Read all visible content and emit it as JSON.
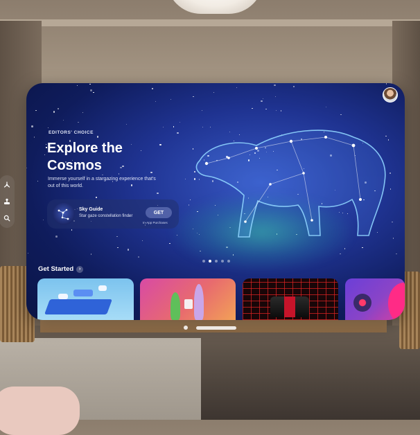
{
  "hero": {
    "eyebrow": "EDITORS' CHOICE",
    "title": "Explore the Cosmos",
    "subtitle": "Immerse yourself in a stargazing experience that's out of this world."
  },
  "featured_app": {
    "name": "Sky Guide",
    "tagline": "Star gaze constellation finder",
    "button_label": "GET",
    "purchase_note": "In-App Purchases"
  },
  "carousel": {
    "pages": 5,
    "active_index": 1
  },
  "section": {
    "title": "Get Started",
    "chevron": "›"
  },
  "tiles": [
    {
      "name": "puzzle-game"
    },
    {
      "name": "chess-game"
    },
    {
      "name": "racing-game"
    },
    {
      "name": "orb-game"
    }
  ],
  "sidebar": {
    "items": [
      {
        "icon": "apps-icon"
      },
      {
        "icon": "arcade-icon"
      },
      {
        "icon": "search-icon"
      }
    ]
  },
  "colors": {
    "sky_deep": "#0f1c5c",
    "sky_mid": "#1f3391",
    "constellation": "#8fd4ff",
    "aurora": "#3cd2aa"
  }
}
